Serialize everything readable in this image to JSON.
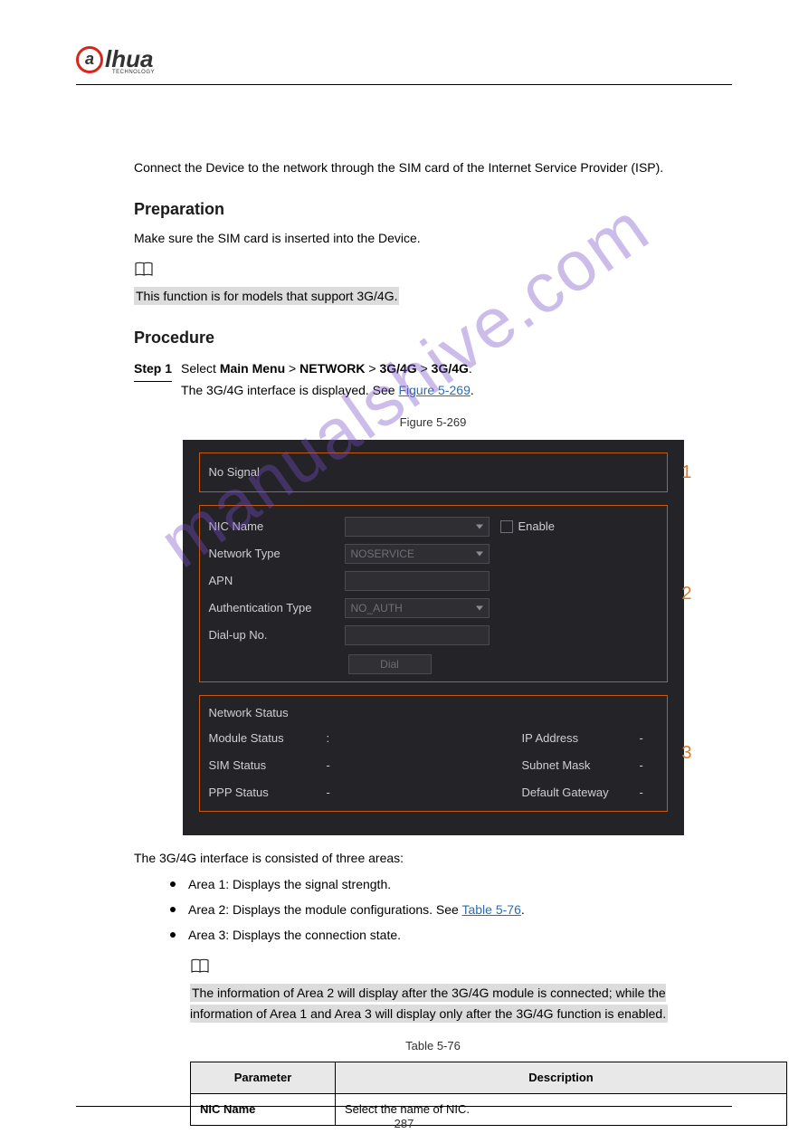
{
  "header": {
    "logo_text": "lhua",
    "logo_sub": "TECHNOLOGY"
  },
  "body": {
    "intro_para": "Connect the Device to the network through the SIM card of the Internet Service Provider (ISP).",
    "prep_heading": "Preparation",
    "prep_text": "Make sure the SIM card is inserted into the Device.",
    "note1": "This function is for models that support 3G/4G.",
    "proc_heading": "Procedure",
    "step1": {
      "label": "Step 1",
      "text_prefix": "Select ",
      "menu1": "Main Menu",
      "menu2": "NETWORK",
      "menu3": "3G/4G",
      "menu4": "3G/4G",
      "follow_prefix": "The 3G/4G interface is displayed. See ",
      "figure_ref": "Figure 5-269"
    },
    "figure_caption": "Figure 5-269",
    "region_intro": "The 3G/4G interface is consisted of three areas:",
    "bullet1": "Area 1: Displays the signal strength.",
    "bullet2a": "Area 2: Displays the module configurations. See",
    "bullet2_ref": "Table 5-76",
    "bullet3": "Area 3: Displays the connection state.",
    "note2": "The information of Area 2 will display after the 3G/4G module is connected; while the information of Area 1 and Area 3 will display only after the 3G/4G function is enabled.",
    "table_caption": "Table 5-76",
    "table": {
      "header": [
        "Parameter",
        "Description"
      ],
      "row1": [
        "NIC Name",
        "Select the name of NIC."
      ]
    }
  },
  "shot": {
    "signal": "No Signal",
    "nums": [
      "1",
      "2",
      "3"
    ],
    "form": {
      "nic_name": "NIC Name",
      "enable": "Enable",
      "network_type": "Network Type",
      "network_type_val": "NOSERVICE",
      "apn": "APN",
      "auth": "Authentication Type",
      "auth_val": "NO_AUTH",
      "dial_no": "Dial-up No.",
      "dial_btn": "Dial"
    },
    "status": {
      "heading": "Network Status",
      "module": "Module Status",
      "ip": "IP Address",
      "sim": "SIM Status",
      "subnet": "Subnet Mask",
      "ppp": "PPP Status",
      "gateway": "Default Gateway"
    }
  },
  "footer": {
    "page": "287"
  },
  "watermark": "manualshive.com"
}
